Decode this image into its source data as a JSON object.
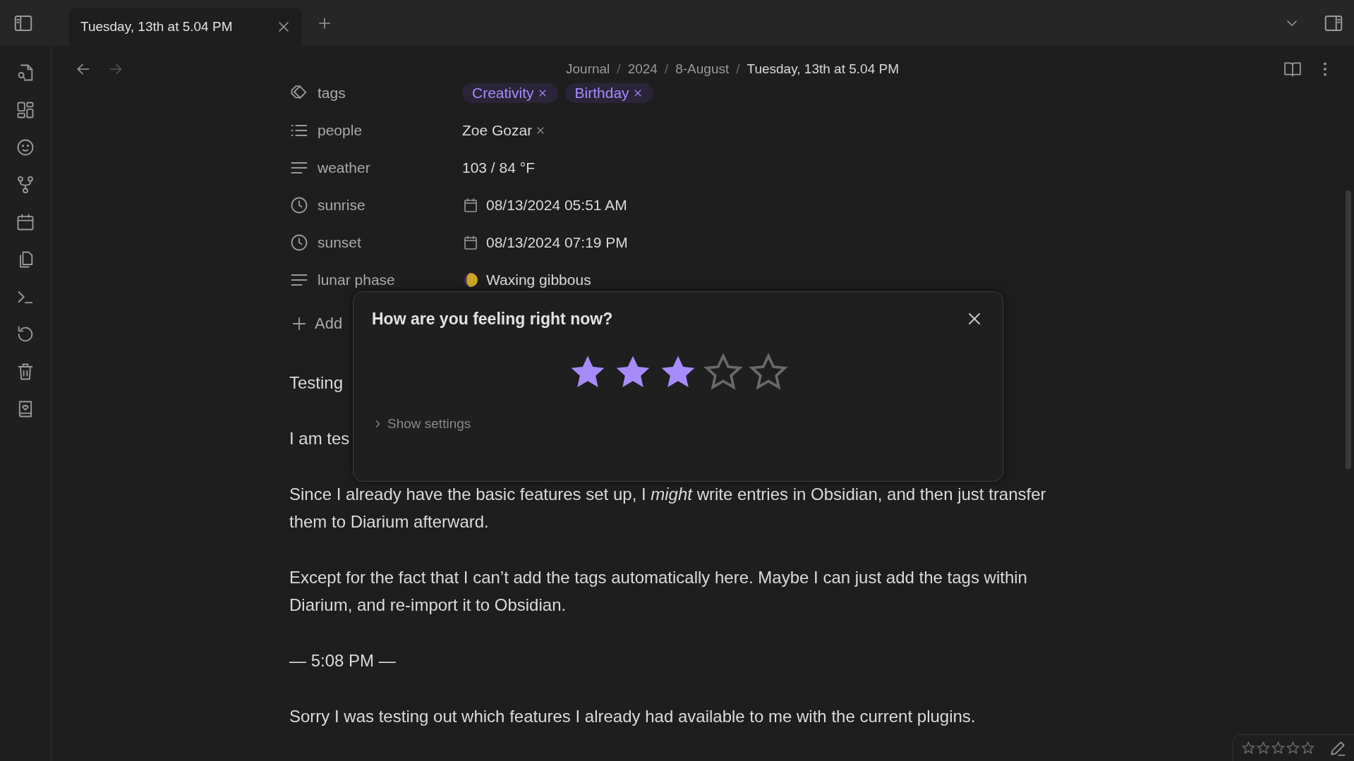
{
  "tabs": [
    {
      "label": "Tuesday, 13th at 5.04 PM",
      "selected": true
    }
  ],
  "breadcrumb": {
    "separator": "/",
    "items": [
      "Journal",
      "2024",
      "8-August",
      "Tuesday, 13th at 5.04 PM"
    ]
  },
  "properties": [
    {
      "kind": "tags",
      "name": "tags",
      "tags": [
        "Creativity",
        "Birthday"
      ]
    },
    {
      "kind": "list",
      "name": "people",
      "items": [
        "Zoe Gozar"
      ]
    },
    {
      "kind": "text",
      "name": "weather",
      "value": "103 / 84 °F"
    },
    {
      "kind": "datetime",
      "name": "sunrise",
      "value": "08/13/2024 05:51 AM"
    },
    {
      "kind": "datetime",
      "name": "sunset",
      "value": "08/13/2024 07:19 PM"
    },
    {
      "kind": "moon",
      "name": "lunar phase",
      "value": "Waxing gibbous"
    }
  ],
  "add_property": "Add",
  "body": [
    {
      "kind": "paragraph",
      "text": "Testing"
    },
    {
      "kind": "paragraph",
      "text": "I am tes"
    },
    {
      "kind": "paragraph",
      "text": "Since I already have the basic features set up, I *might* write entries in Obsidian, and then just transfer them to Diarium afterward."
    },
    {
      "kind": "paragraph",
      "text": "Except for the fact that I can’t add the tags automatically here. Maybe I can just add the tags within Diarium, and re-import it to Obsidian."
    },
    {
      "kind": "paragraph",
      "text": "— 5:08 PM —"
    },
    {
      "kind": "paragraph",
      "text": "Sorry I was testing out which features I already had available to me with the current plugins."
    }
  ],
  "modal": {
    "title": "How are you feeling right now?",
    "stars": 3,
    "settings": "Show settings"
  },
  "status_bar": {
    "stars": 0
  }
}
